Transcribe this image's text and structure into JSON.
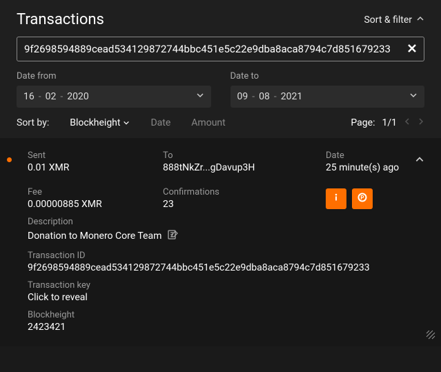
{
  "header": {
    "title": "Transactions",
    "sortFilter": "Sort & filter"
  },
  "search": {
    "value": "9f2698594889cead534129872744bbc451e5c22e9dba8aca8794c7d851679233"
  },
  "dateFrom": {
    "label": "Date from",
    "day": "16",
    "month": "02",
    "year": "2020"
  },
  "dateTo": {
    "label": "Date to",
    "day": "09",
    "month": "08",
    "year": "2021"
  },
  "sort": {
    "label": "Sort by:",
    "options": {
      "blockheight": "Blockheight",
      "date": "Date",
      "amount": "Amount"
    }
  },
  "pagination": {
    "label": "Page:",
    "current": "1",
    "total": "1"
  },
  "tx": {
    "sent": {
      "label": "Sent",
      "value": "0.01 XMR"
    },
    "to": {
      "label": "To",
      "value": "888tNkZr...gDavup3H"
    },
    "date": {
      "label": "Date",
      "value": "25 minute(s) ago"
    },
    "fee": {
      "label": "Fee",
      "value": "0.00000885 XMR"
    },
    "confirmations": {
      "label": "Confirmations",
      "value": "23"
    },
    "description": {
      "label": "Description",
      "value": "Donation to Monero Core Team"
    },
    "txid": {
      "label": "Transaction ID",
      "value": "9f2698594889cead534129872744bbc451e5c22e9dba8aca8794c7d851679233"
    },
    "txkey": {
      "label": "Transaction key",
      "value": "Click to reveal"
    },
    "blockheight": {
      "label": "Blockheight",
      "value": "2423421"
    }
  }
}
